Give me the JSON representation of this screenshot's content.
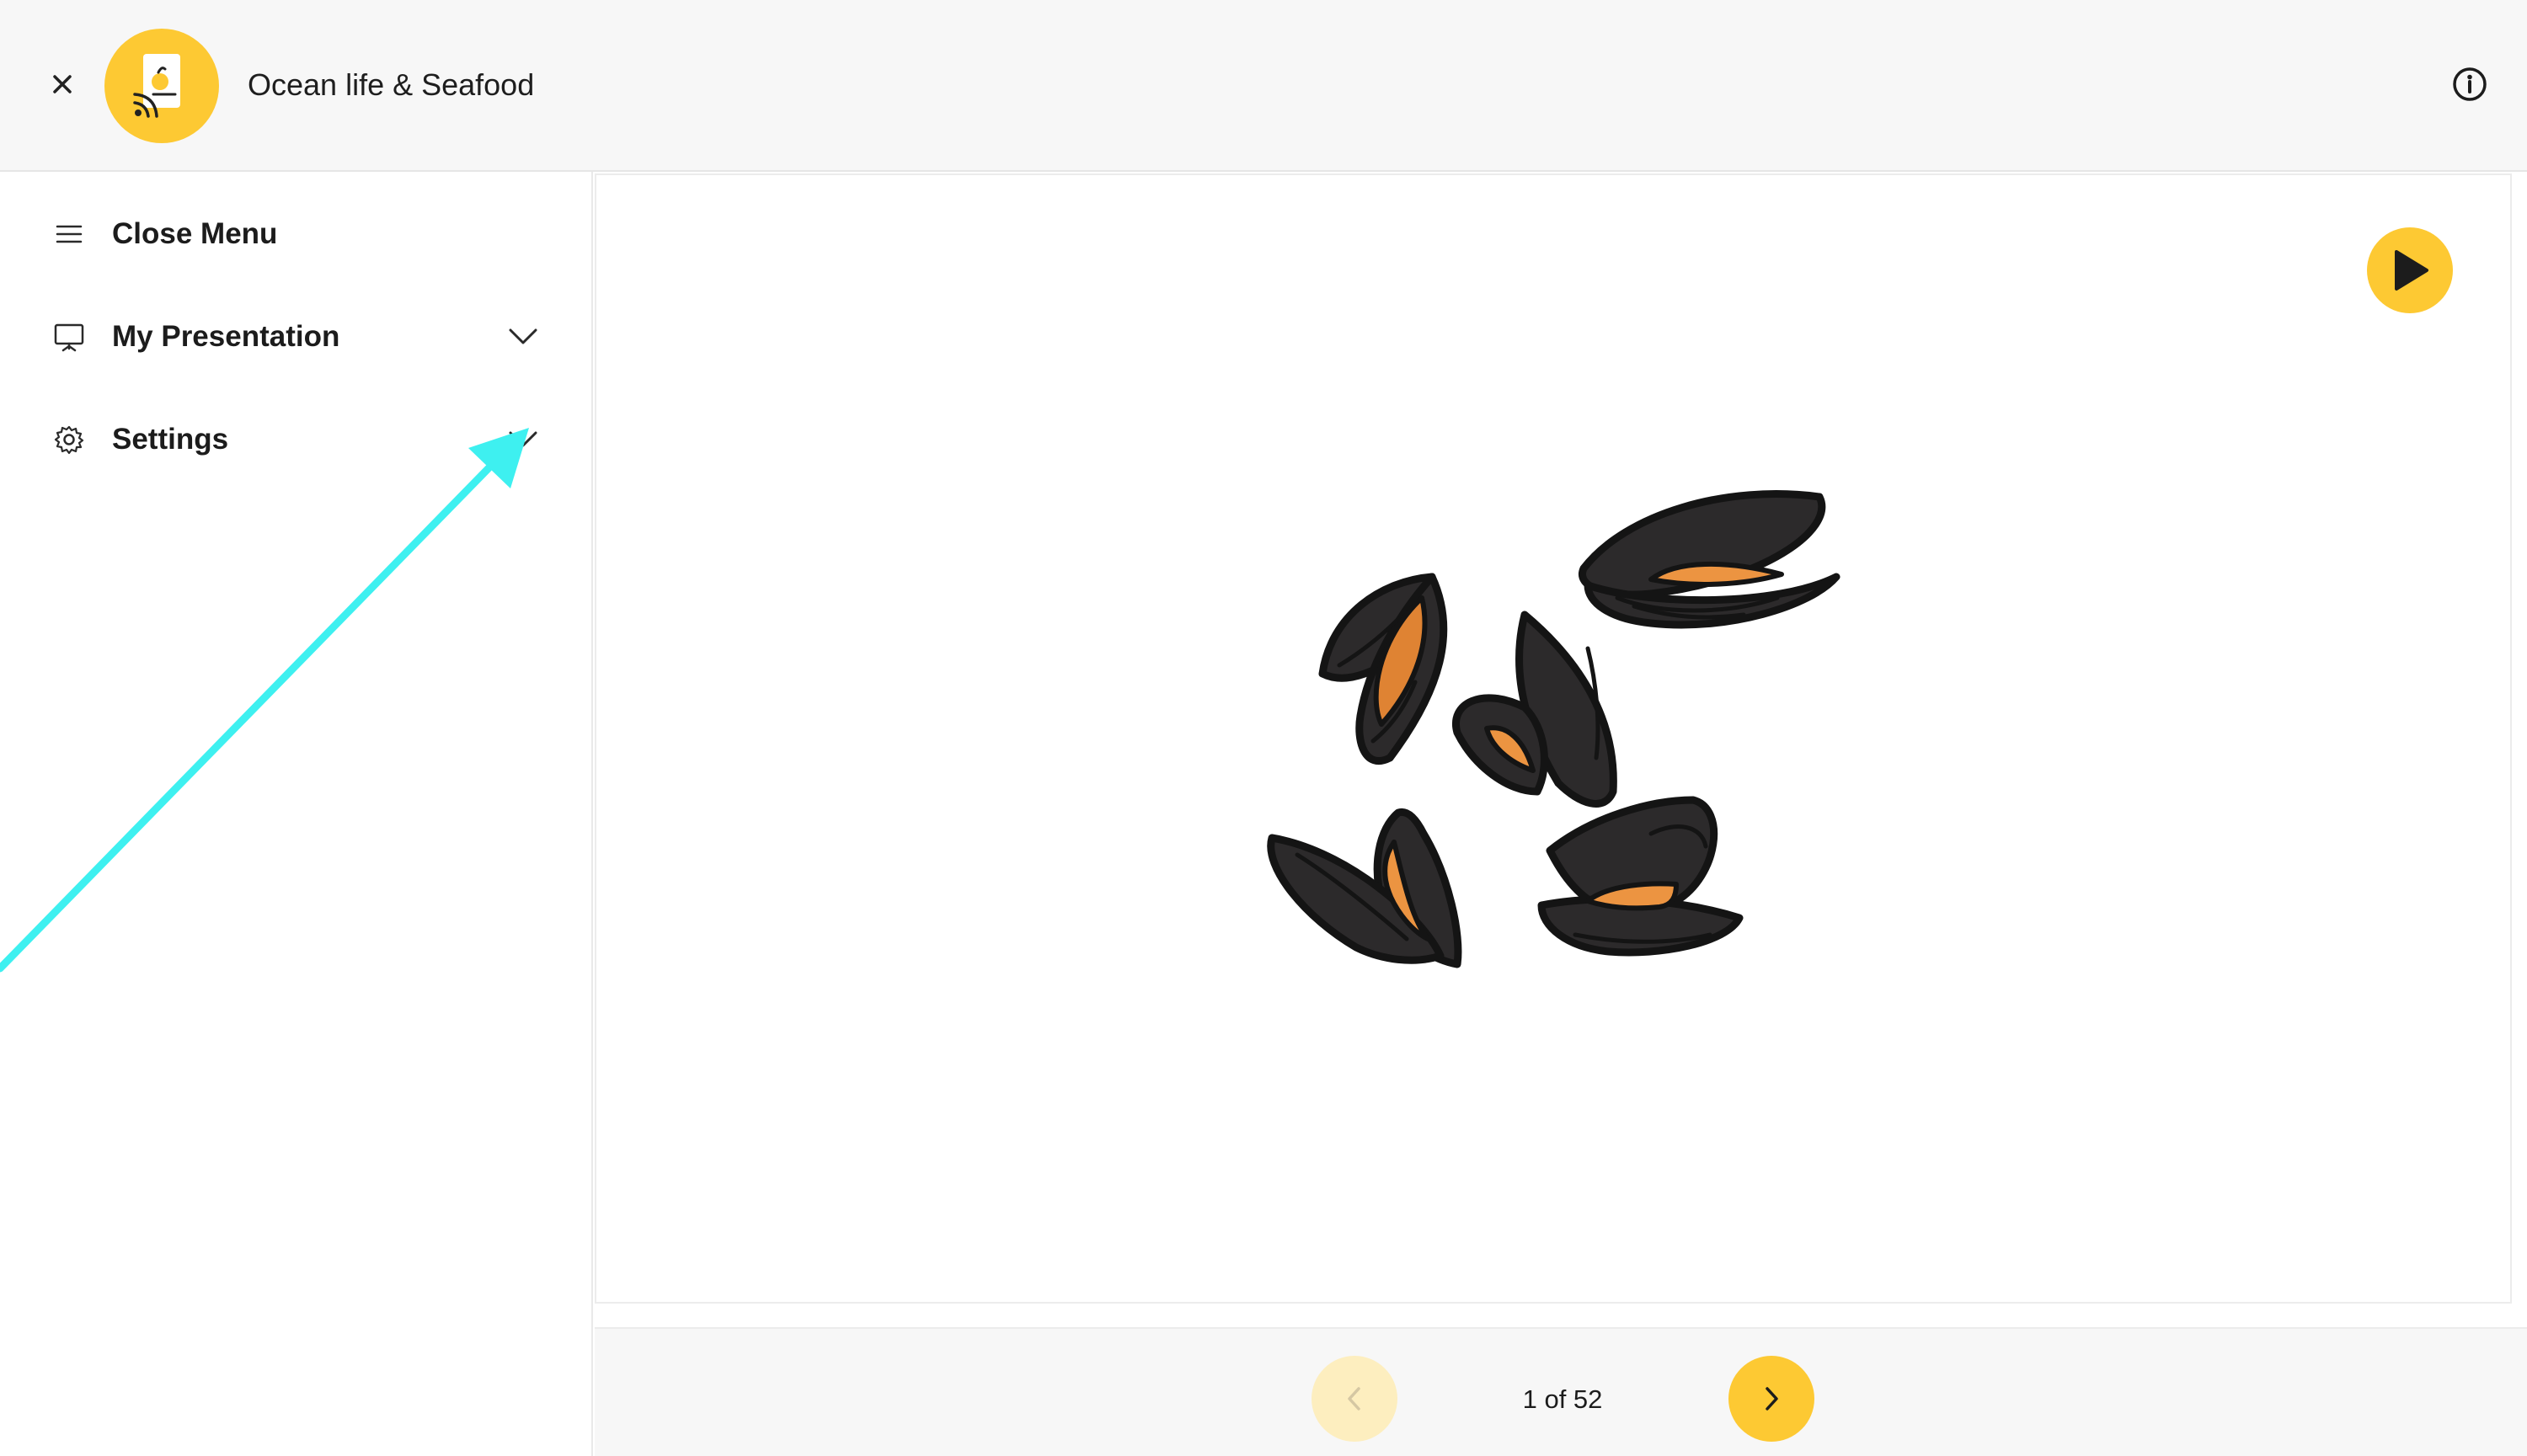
{
  "header": {
    "title": "Ocean life & Seafood",
    "close_icon": "close-icon",
    "logo_icon": "app-logo-icon",
    "info_icon": "info-icon"
  },
  "sidebar": {
    "items": [
      {
        "label": "Close Menu",
        "icon": "hamburger-menu-icon"
      },
      {
        "label": "My Presentation",
        "icon": "presentation-screen-icon",
        "expandable": true
      },
      {
        "label": "Settings",
        "icon": "gear-icon",
        "expandable": true
      }
    ]
  },
  "slide": {
    "image": "mussels-illustration",
    "play_icon": "play-icon"
  },
  "footer": {
    "page_indicator": "1 of 52",
    "prev_icon": "chevron-left-icon",
    "next_icon": "chevron-right-icon"
  },
  "annotation": {
    "arrow_color": "#3ef0f0",
    "points_to": "settings-chevron"
  },
  "colors": {
    "accent": "#fdc933",
    "accent_disabled": "#fdeebf",
    "header_bg": "#f7f7f7",
    "mussel_shell": "#2c2a2b",
    "mussel_flesh": "#ec9441"
  }
}
